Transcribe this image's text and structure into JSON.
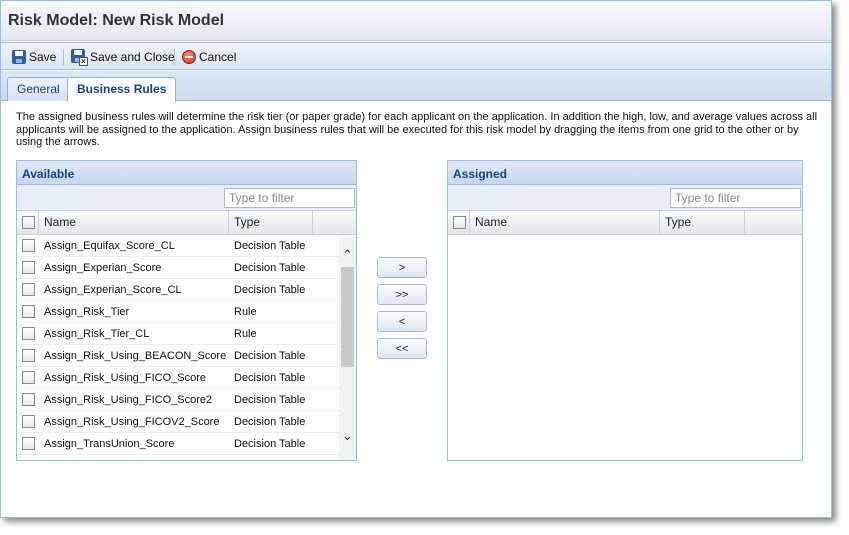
{
  "window": {
    "title": "Risk Model: New Risk Model"
  },
  "toolbar": {
    "save_label": "Save",
    "save_close_label": "Save and Close",
    "cancel_label": "Cancel"
  },
  "tabs": [
    {
      "label": "General",
      "active": false
    },
    {
      "label": "Business Rules",
      "active": true
    }
  ],
  "description": "The assigned business rules will determine the risk tier (or paper grade) for each applicant on the application. In addition the high, low, and average values across all applicants will be assigned to the application. Assign business rules that will be executed for this risk model by dragging the items from one grid to the other or by using the arrows.",
  "available": {
    "title": "Available",
    "filter_placeholder": "Type to filter",
    "columns": {
      "name": "Name",
      "type": "Type"
    },
    "rows": [
      {
        "name": "Assign_Equifax_Score_CL",
        "type": "Decision Table"
      },
      {
        "name": "Assign_Experian_Score",
        "type": "Decision Table"
      },
      {
        "name": "Assign_Experian_Score_CL",
        "type": "Decision Table"
      },
      {
        "name": "Assign_Risk_Tier",
        "type": "Rule"
      },
      {
        "name": "Assign_Risk_Tier_CL",
        "type": "Rule"
      },
      {
        "name": "Assign_Risk_Using_BEACON_Score",
        "type": "Decision Table"
      },
      {
        "name": "Assign_Risk_Using_FICO_Score",
        "type": "Decision Table"
      },
      {
        "name": "Assign_Risk_Using_FICO_Score2",
        "type": "Decision Table"
      },
      {
        "name": "Assign_Risk_Using_FICOV2_Score",
        "type": "Decision Table"
      },
      {
        "name": "Assign_TransUnion_Score",
        "type": "Decision Table"
      }
    ]
  },
  "assigned": {
    "title": "Assigned",
    "filter_placeholder": "Type to filter",
    "columns": {
      "name": "Name",
      "type": "Type"
    }
  },
  "move_buttons": {
    "add_one": ">",
    "add_all": ">>",
    "remove_one": "<",
    "remove_all": "<<"
  },
  "icons": {
    "save": "floppy-disk-icon",
    "save_close": "floppy-disk-close-icon",
    "cancel": "cancel-icon",
    "scroll_up": "chevron-up-icon",
    "scroll_down": "chevron-down-icon"
  }
}
